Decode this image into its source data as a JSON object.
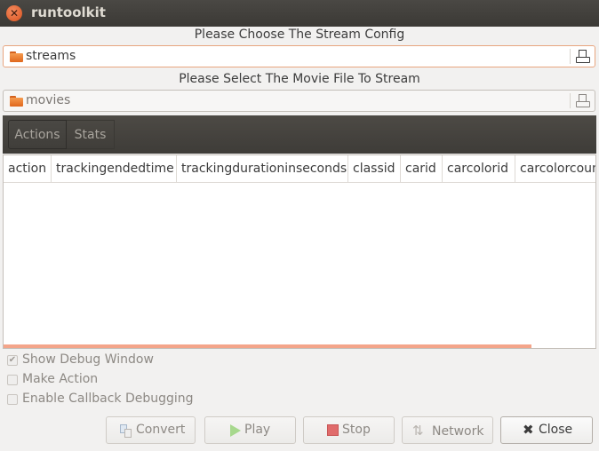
{
  "window": {
    "title": "runtoolkit"
  },
  "stream_config": {
    "caption": "Please Choose The Stream Config",
    "value": "streams"
  },
  "movie_file": {
    "caption": "Please Select The Movie File To Stream",
    "value": "movies"
  },
  "tabs": [
    {
      "label": "Actions",
      "active": true
    },
    {
      "label": "Stats",
      "active": false
    }
  ],
  "table": {
    "columns": [
      "action",
      "trackingendedtime",
      "trackingdurationinseconds",
      "classid",
      "carid",
      "carcolorid",
      "carcolorcount"
    ],
    "rows": []
  },
  "options": [
    {
      "label": "Show Debug Window",
      "checked": true
    },
    {
      "label": "Make Action",
      "checked": false
    },
    {
      "label": "Enable Callback Debugging",
      "checked": false
    }
  ],
  "buttons": {
    "convert": "Convert",
    "play": "Play",
    "stop": "Stop",
    "network": "Network",
    "close": "Close"
  },
  "colors": {
    "accent": "#e8a57f",
    "scrollbar": "#f4a58a",
    "titlebar": "#3b3935"
  }
}
